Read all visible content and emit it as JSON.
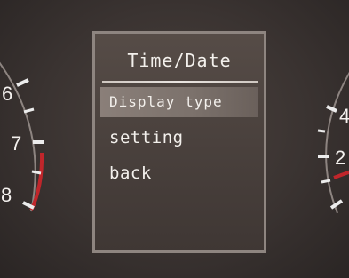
{
  "menu": {
    "title": "Time/Date",
    "items": [
      {
        "label": "Display type",
        "selected": true
      },
      {
        "label": "setting",
        "selected": false
      },
      {
        "label": "back",
        "selected": false
      }
    ]
  },
  "left_gauge": {
    "labels": [
      "6",
      "7",
      "8"
    ]
  },
  "right_gauge": {
    "labels": [
      "4",
      "2"
    ]
  },
  "colors": {
    "redline": "#c0262b",
    "needle": "#e0e0e0",
    "panel_border": "#8e8580",
    "selection": "#7b716b"
  }
}
